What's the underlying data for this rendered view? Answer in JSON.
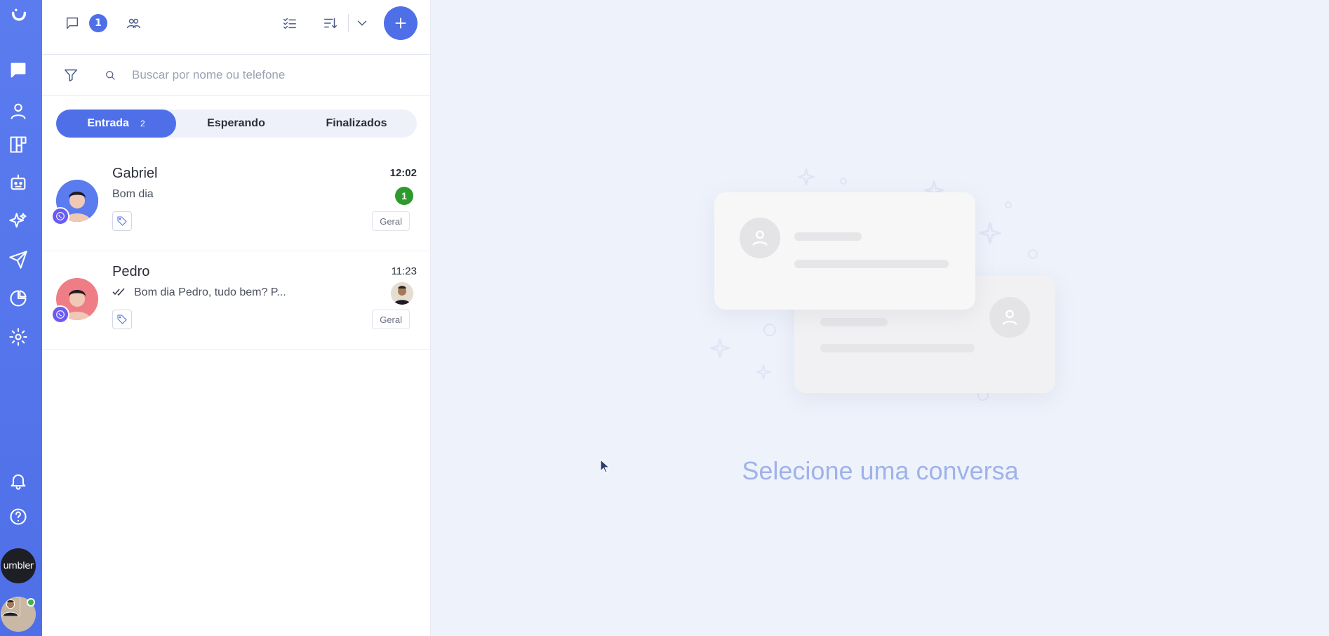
{
  "rail": {
    "items": [
      "brand-logo",
      "chat-icon",
      "contacts-icon",
      "kanban-icon",
      "bot-icon",
      "sparkles-icon",
      "send-icon",
      "reports-icon",
      "settings-icon"
    ],
    "bottom": [
      "bell-icon",
      "help-icon"
    ],
    "workspace_label": "umbler"
  },
  "topbar": {
    "chat_count": "1"
  },
  "search": {
    "placeholder": "Buscar por nome ou telefone"
  },
  "tabs": [
    {
      "label": "Entrada",
      "count": "2"
    },
    {
      "label": "Esperando"
    },
    {
      "label": "Finalizados"
    }
  ],
  "conversations": [
    {
      "name": "Gabriel",
      "message": "Bom dia",
      "time": "12:02",
      "unread": "1",
      "department": "Geral"
    },
    {
      "name": "Pedro",
      "message": "Bom dia Pedro, tudo bem? P...",
      "time": "11:23",
      "department": "Geral"
    }
  ],
  "empty_state": {
    "title": "Selecione uma conversa"
  },
  "colors": {
    "accent": "#4f6fe8",
    "unread": "#2e9a2e",
    "channel": "#6b5cf0"
  }
}
